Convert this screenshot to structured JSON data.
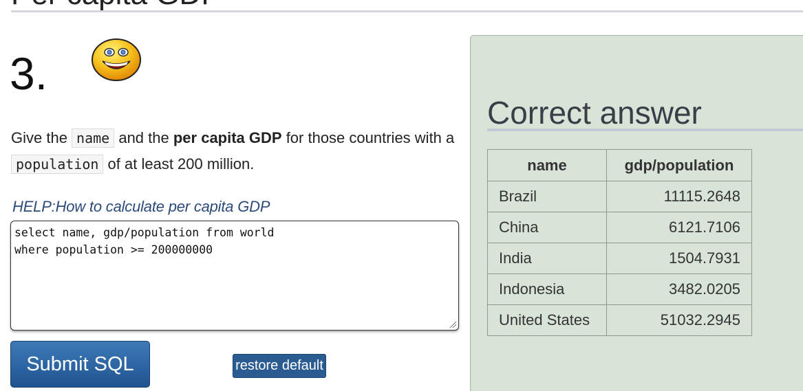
{
  "page": {
    "top_heading": "Per capita GDP",
    "question_number": "3."
  },
  "question": {
    "parts": [
      "Give the ",
      "name",
      " and the ",
      "per capita GDP",
      " for those countries with a ",
      "population",
      " of at least 200 million."
    ]
  },
  "help": {
    "label": "HELP:How to calculate per capita GDP"
  },
  "editor": {
    "sql": "select name, gdp/population from world\nwhere population >= 200000000"
  },
  "buttons": {
    "submit_label": "Submit SQL",
    "restore_label": "restore default"
  },
  "answer": {
    "title": "Correct answer",
    "columns": [
      "name",
      "gdp/population"
    ],
    "rows": [
      [
        "Brazil",
        "11115.2648"
      ],
      [
        "China",
        "6121.7106"
      ],
      [
        "India",
        "1504.7931"
      ],
      [
        "Indonesia",
        "3482.0205"
      ],
      [
        "United States",
        "51032.2945"
      ]
    ]
  },
  "colors": {
    "panel_bg": "#d9e4d9",
    "button_blue": "#2a5b91",
    "link": "#2c4a7a"
  },
  "icons": {
    "smiley": "smiley-face-icon"
  }
}
